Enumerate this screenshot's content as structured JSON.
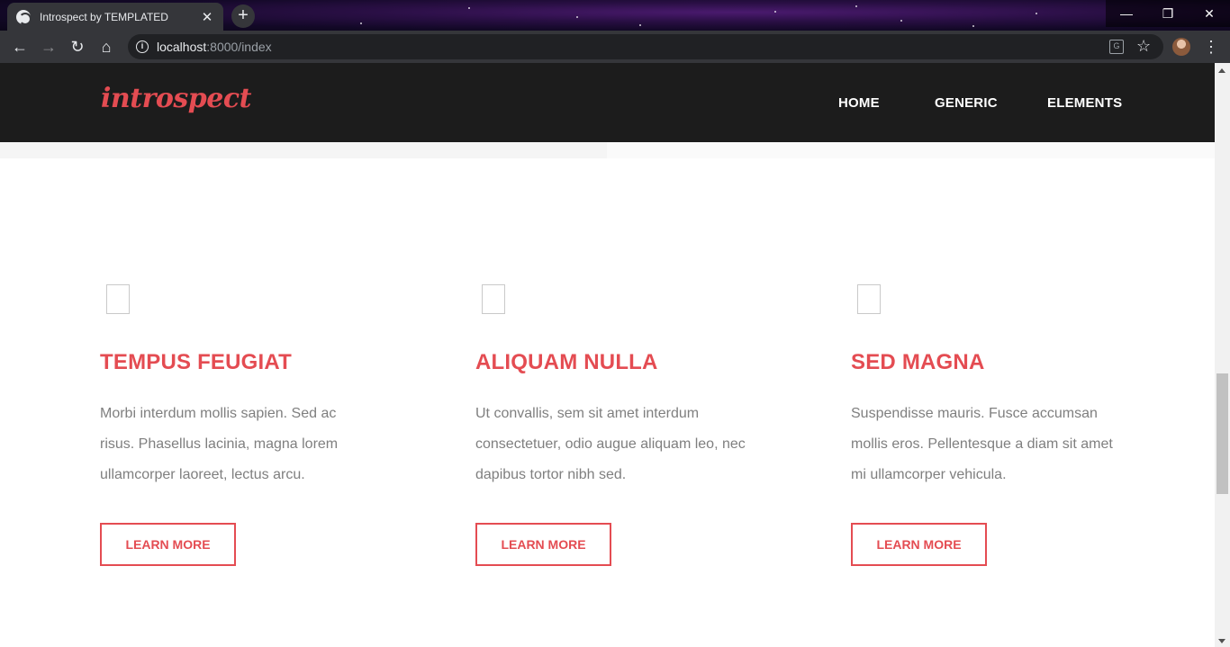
{
  "browser": {
    "tab_title": "Introspect by TEMPLATED",
    "tab_close": "✕",
    "new_tab": "+",
    "url_host": "localhost",
    "url_path": ":8000/index",
    "controls": {
      "minimize": "—",
      "maximize": "❐",
      "close": "✕"
    },
    "buttons": {
      "back": "←",
      "forward": "→",
      "reload": "↻",
      "home": "⌂",
      "menu": "⋮",
      "bookmark": "☆",
      "info": "i",
      "translate": "G"
    }
  },
  "site": {
    "logo": "introspect",
    "nav": [
      "HOME",
      "GENERIC",
      "ELEMENTS"
    ]
  },
  "features": [
    {
      "title": "TEMPUS FEUGIAT",
      "text": "Morbi interdum mollis sapien. Sed ac risus. Phasellus lacinia, magna lorem ullamcorper laoreet, lectus arcu.",
      "button": "LEARN MORE"
    },
    {
      "title": "ALIQUAM NULLA",
      "text": "Ut convallis, sem sit amet interdum consectetuer, odio augue aliquam leo, nec dapibus tortor nibh sed.",
      "button": "LEARN MORE"
    },
    {
      "title": "SED MAGNA",
      "text": "Suspendisse mauris. Fusce accumsan mollis eros. Pellentesque a diam sit amet mi ullamcorper vehicula.",
      "button": "LEARN MORE"
    }
  ],
  "colors": {
    "accent": "#e44c52",
    "header_bg": "#1c1c1c",
    "body_text": "#7f7f7f"
  },
  "icons": {
    "feature_icon": "placeholder-box-icon"
  }
}
